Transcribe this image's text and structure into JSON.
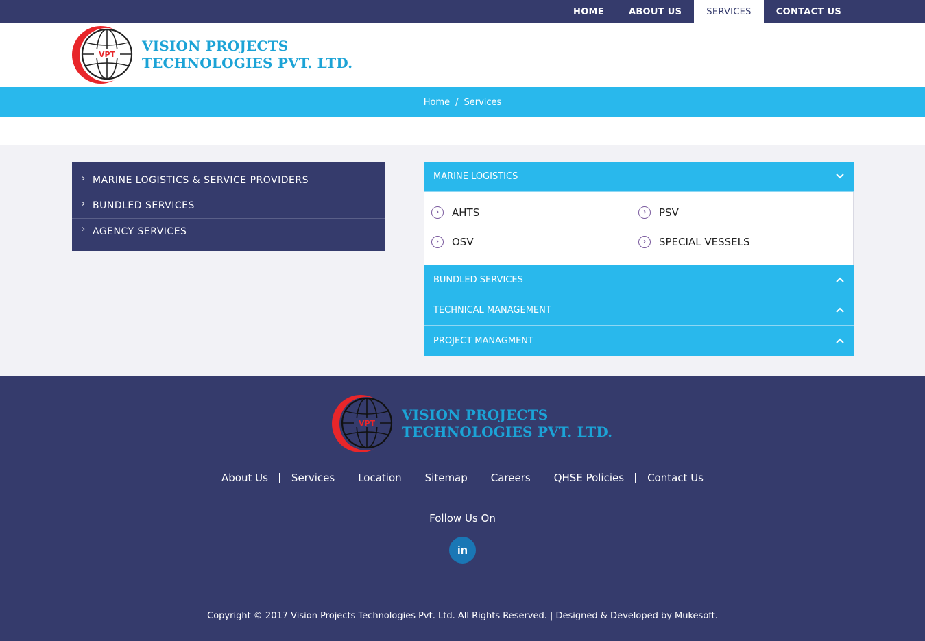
{
  "nav": {
    "items": [
      {
        "label": "HOME"
      },
      {
        "label": "ABOUT US"
      },
      {
        "label": "SERVICES"
      },
      {
        "label": "CONTACT US"
      }
    ]
  },
  "brand": {
    "line1": "VISION PROJECTS",
    "line2": "TECHNOLOGIES PVT. LTD.",
    "monogram": "VPT"
  },
  "breadcrumb": {
    "home": "Home",
    "separator": "/",
    "current": "Services"
  },
  "sidebar": {
    "items": [
      {
        "label": "MARINE LOGISTICS & SERVICE PROVIDERS"
      },
      {
        "label": "BUNDLED SERVICES"
      },
      {
        "label": "AGENCY SERVICES"
      }
    ]
  },
  "accordion": {
    "sections": [
      {
        "title": "MARINE LOGISTICS",
        "expanded": true,
        "items": [
          "AHTS",
          "PSV",
          "OSV",
          "SPECIAL VESSELS"
        ]
      },
      {
        "title": "BUNDLED SERVICES",
        "expanded": false
      },
      {
        "title": "TECHNICAL MANAGEMENT",
        "expanded": false
      },
      {
        "title": "PROJECT MANAGMENT",
        "expanded": false
      }
    ]
  },
  "footer": {
    "links": [
      {
        "label": "About Us"
      },
      {
        "label": "Services"
      },
      {
        "label": "Location"
      },
      {
        "label": "Sitemap"
      },
      {
        "label": "Careers"
      },
      {
        "label": "QHSE Policies"
      },
      {
        "label": "Contact Us"
      }
    ],
    "follow": "Follow Us On",
    "social_icon": "linkedin-icon",
    "social_text": "in",
    "copyright": "Copyright © 2017 Vision Projects Technologies Pvt. Ltd. All Rights Reserved. | Designed & Developed by Mukesoft."
  },
  "colors": {
    "navy": "#353b6c",
    "accent": "#29b8ec",
    "brand_text": "#1ca3d6",
    "logo_red": "#e8262a",
    "linkedin": "#1a77b5"
  }
}
